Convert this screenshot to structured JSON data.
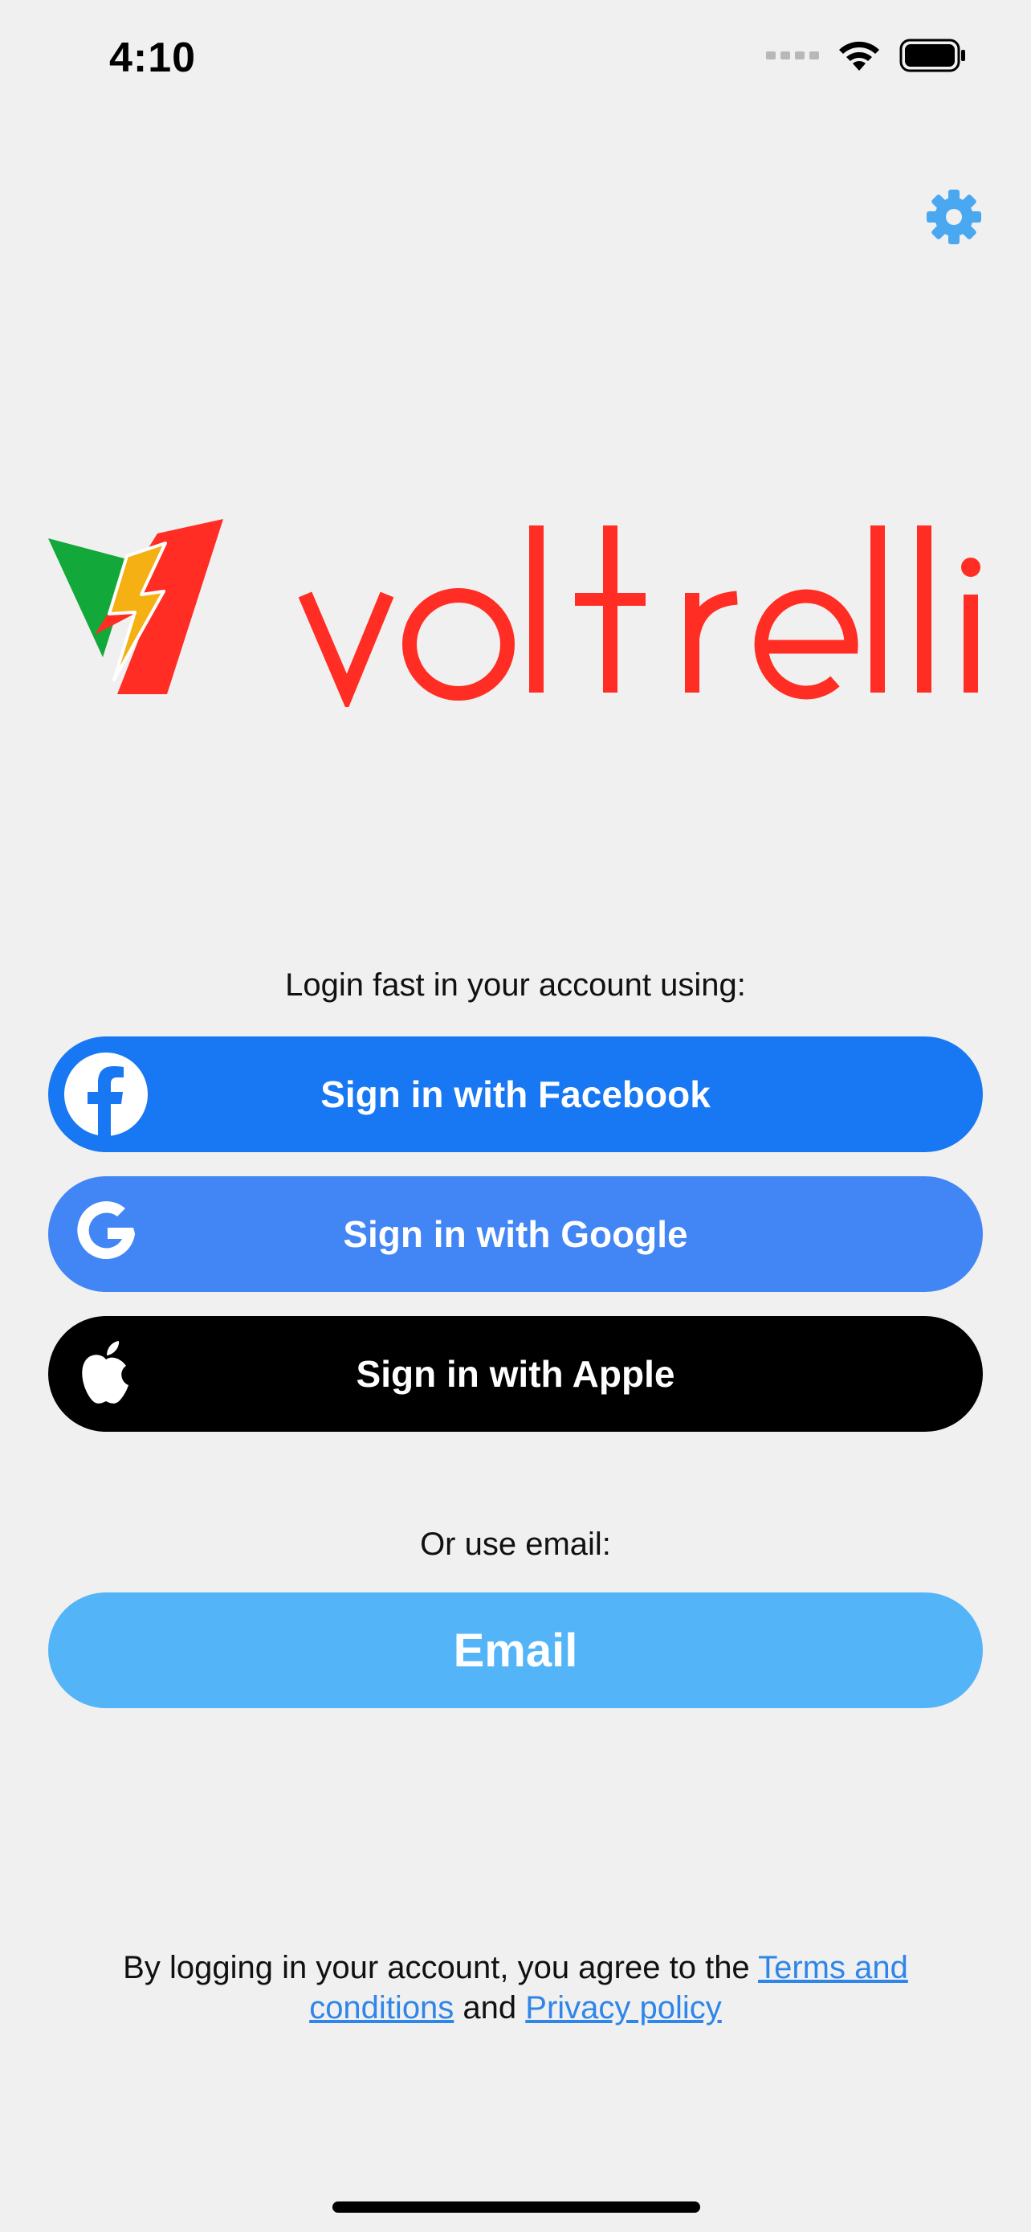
{
  "status_bar": {
    "time": "4:10"
  },
  "icons": {
    "settings": "gear-icon",
    "facebook": "facebook-icon",
    "google": "google-icon",
    "apple": "apple-icon",
    "wifi": "wifi-icon",
    "battery": "battery-icon"
  },
  "logo": {
    "wordmark": "voltrelli"
  },
  "login": {
    "prompt": "Login fast in your account using:",
    "facebook_label": "Sign in with Facebook",
    "google_label": "Sign in with Google",
    "apple_label": "Sign in with Apple",
    "email_prompt": "Or use email:",
    "email_label": "Email"
  },
  "footer": {
    "text_before": "By logging in your account, you agree to the ",
    "terms_link": "Terms and conditions",
    "text_middle": " and ",
    "privacy_link": "Privacy policy"
  },
  "colors": {
    "background": "#f0f0f0",
    "facebook": "#1877f2",
    "google": "#4285f4",
    "apple": "#000000",
    "email": "#54b4f8",
    "brand_red": "#ff2d23",
    "link": "#2f86e8",
    "gear": "#4aa8f0"
  }
}
